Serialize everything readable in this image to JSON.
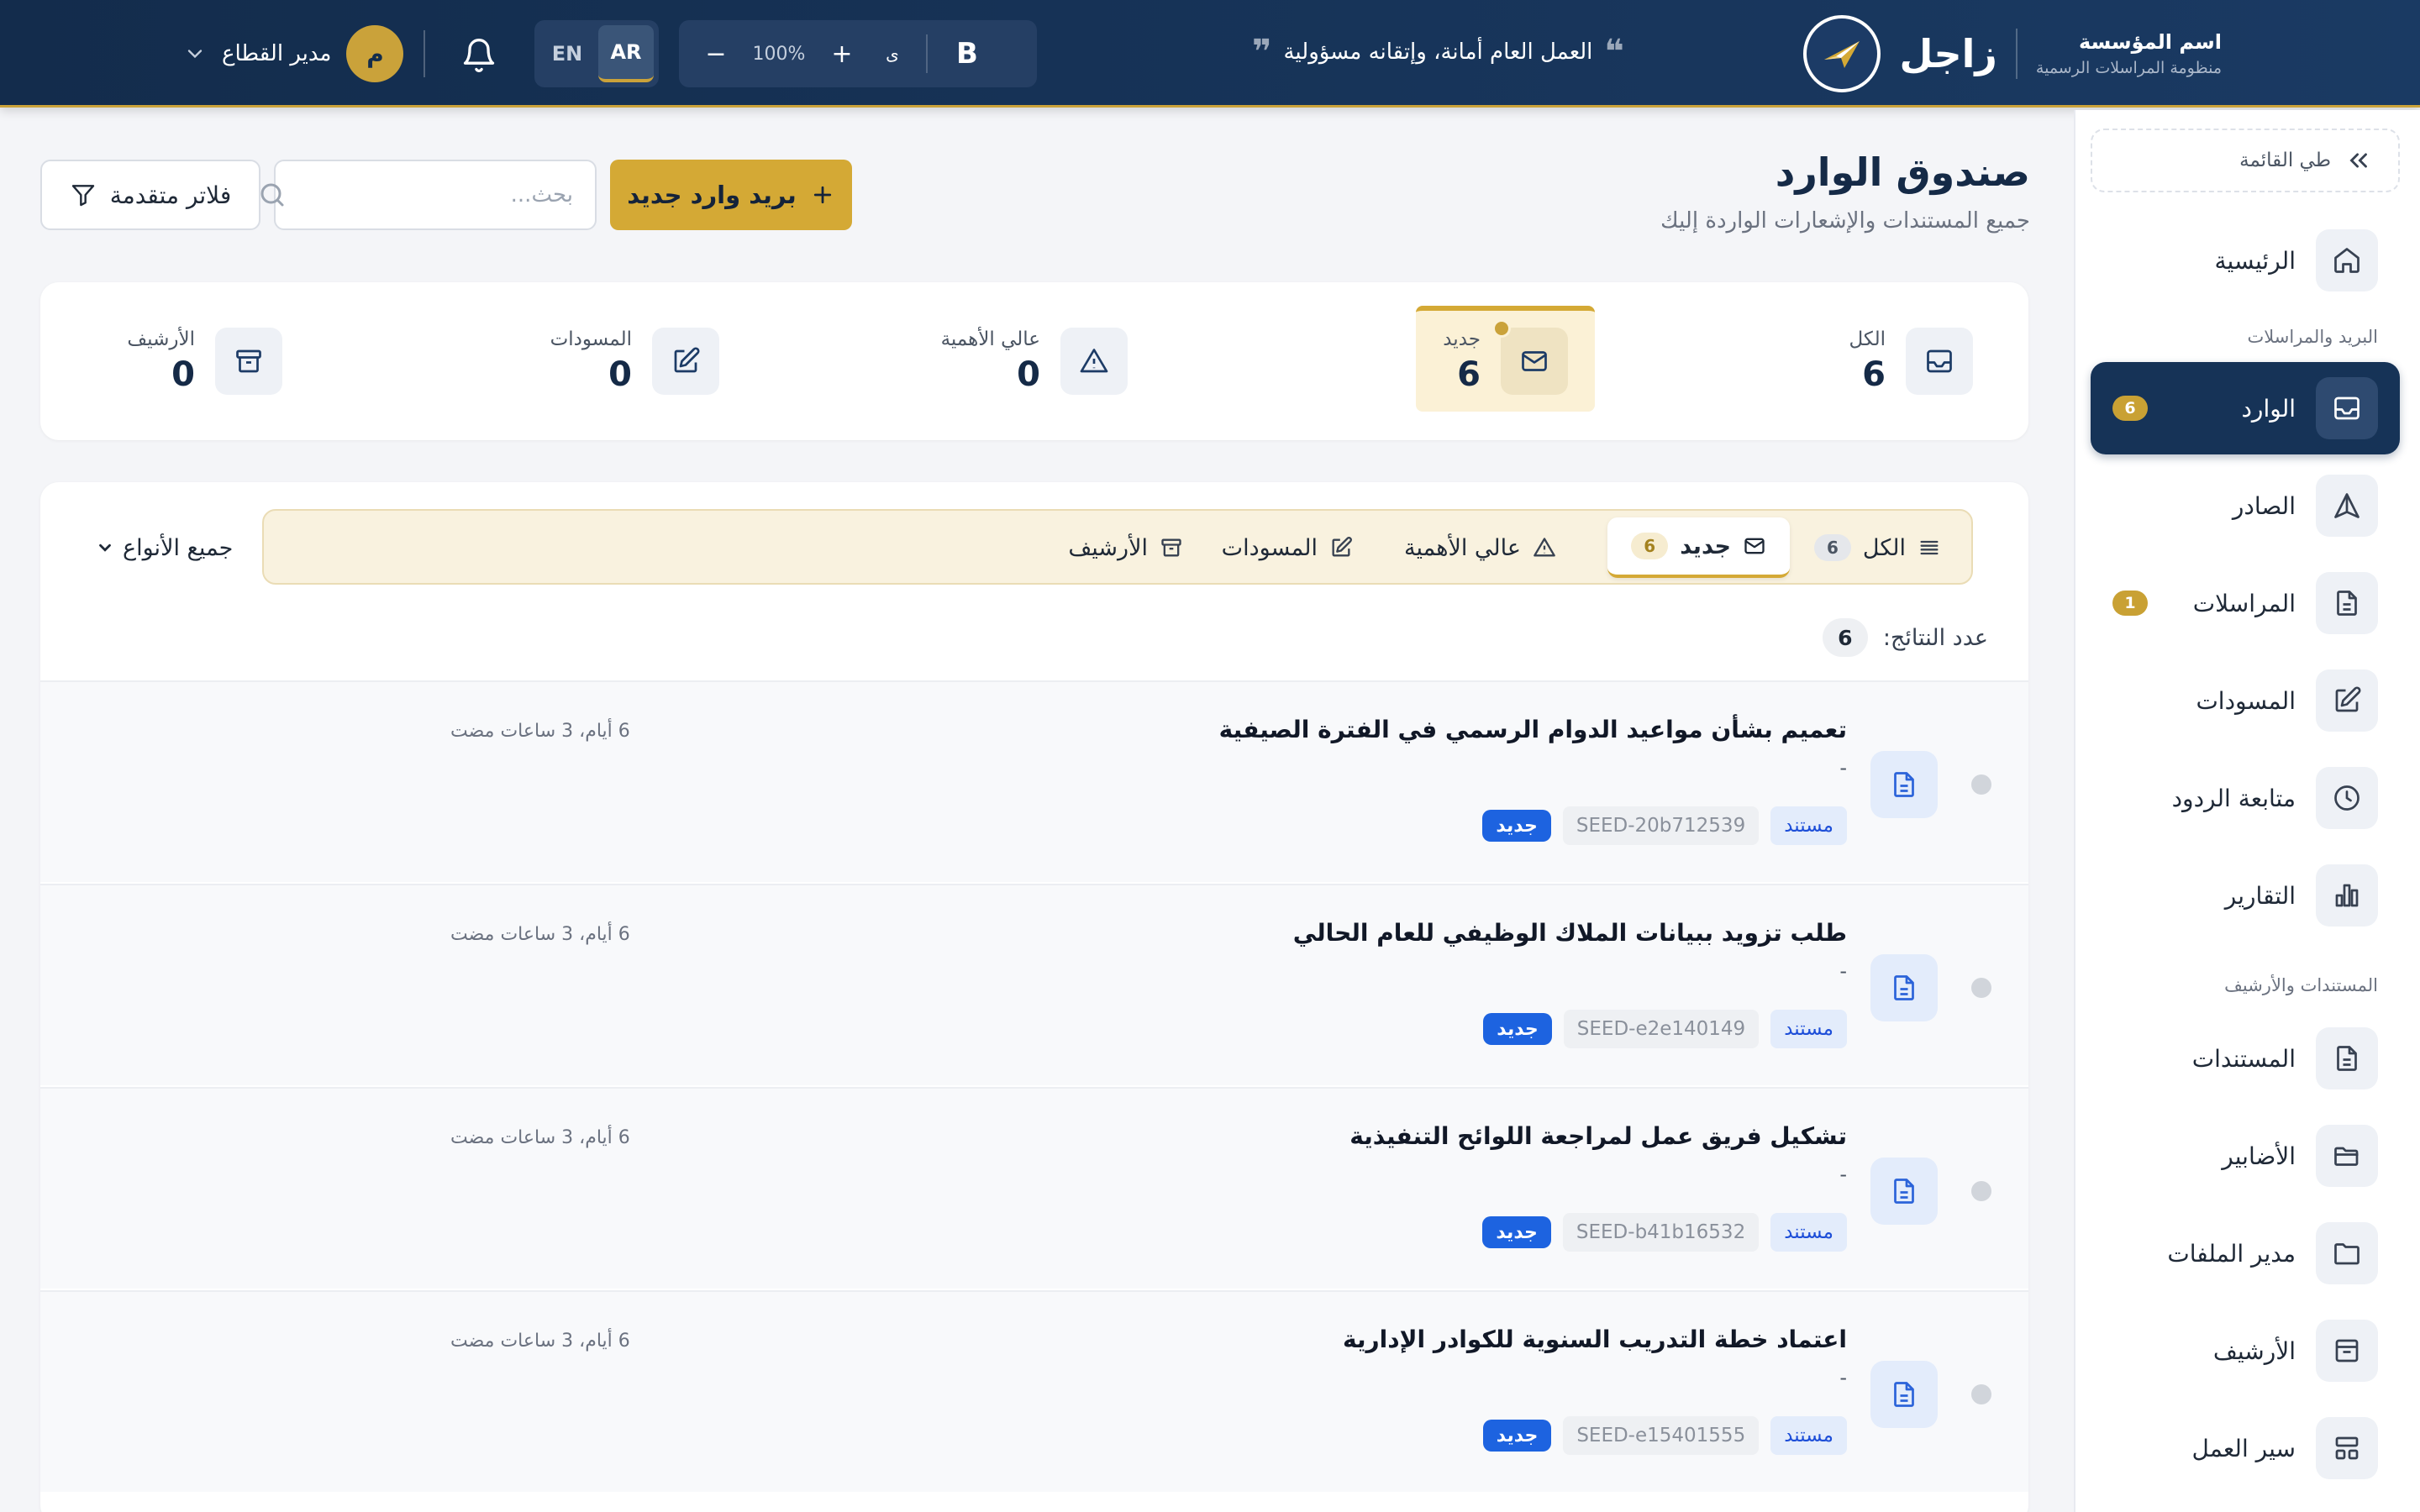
{
  "brand": {
    "name": "زاجل",
    "org_name": "اسم المؤسسة",
    "org_sub": "منظومة المراسلات الرسمية",
    "logo_icon": "paper-plane-icon"
  },
  "header": {
    "motto": "العمل العام أمانة، وإتقانه مسؤولية",
    "zoom": {
      "bold_label": "B",
      "font_label": "ى",
      "plus": "+",
      "value": "100%",
      "minus": "−"
    },
    "lang": {
      "en": "EN",
      "ar": "AR",
      "active": "AR"
    },
    "user": {
      "initial": "م",
      "name": "مدير القطاع"
    },
    "colors": {
      "bg": "#132c4c",
      "accent": "#caa23a"
    }
  },
  "sidebar": {
    "collapse_label": "طي القائمة",
    "home": {
      "label": "الرئيسية",
      "icon": "home-icon"
    },
    "section_mail": "البريد والمراسلات",
    "mail_items": [
      {
        "label": "الوارد",
        "icon": "inbox-icon",
        "badge": "6",
        "active": true
      },
      {
        "label": "الصادر",
        "icon": "send-icon",
        "badge": "",
        "active": false
      },
      {
        "label": "المراسلات",
        "icon": "document-icon",
        "badge": "1",
        "active": false
      },
      {
        "label": "المسودات",
        "icon": "edit-icon",
        "badge": "",
        "active": false
      },
      {
        "label": "متابعة الردود",
        "icon": "clock-icon",
        "badge": "",
        "active": false
      },
      {
        "label": "التقارير",
        "icon": "bar-chart-icon",
        "badge": "",
        "active": false
      }
    ],
    "section_docs": "المستندات والأرشيف",
    "doc_items": [
      {
        "label": "المستندات",
        "icon": "document-icon"
      },
      {
        "label": "الأضابير",
        "icon": "folder-open-icon"
      },
      {
        "label": "مدير الملفات",
        "icon": "folder-icon"
      },
      {
        "label": "الأرشيف",
        "icon": "archive-icon"
      },
      {
        "label": "سير العمل",
        "icon": "workflow-icon"
      }
    ]
  },
  "main": {
    "title": "صندوق الوارد",
    "subtitle": "جميع المستندات والإشعارات الواردة إليك",
    "new_button": "بريد وارد جديد",
    "search_placeholder": "بحث...",
    "filter_button": "فلاتر متقدمة"
  },
  "stats": [
    {
      "label": "الكل",
      "value": "6",
      "icon": "inbox-icon",
      "active": false
    },
    {
      "label": "جديد",
      "value": "6",
      "icon": "envelope-icon",
      "active": true
    },
    {
      "label": "عالي الأهمية",
      "value": "0",
      "icon": "warning-icon",
      "active": false
    },
    {
      "label": "المسودات",
      "value": "0",
      "icon": "edit-icon",
      "active": false
    },
    {
      "label": "الأرشيف",
      "value": "0",
      "icon": "archive-icon",
      "active": false
    }
  ],
  "tabs": [
    {
      "label": "الكل",
      "count": "6",
      "icon": "list-icon",
      "active": false
    },
    {
      "label": "جديد",
      "count": "6",
      "icon": "envelope-icon",
      "active": true
    },
    {
      "label": "عالي الأهمية",
      "count": "",
      "icon": "warning-icon",
      "active": false
    },
    {
      "label": "المسودات",
      "count": "",
      "icon": "edit-icon",
      "active": false
    },
    {
      "label": "الأرشيف",
      "count": "",
      "icon": "archive-icon",
      "active": false
    }
  ],
  "type_filter": "جميع الأنواع",
  "results": {
    "label": "عدد النتائج:",
    "count": "6"
  },
  "items": [
    {
      "title": "تعميم بشأن مواعيد الدوام الرسمي في الفترة الصيفية",
      "subtitle": "-",
      "type": "مستند",
      "code": "SEED-20b712539",
      "status": "جديد",
      "time": "6 أيام، 3 ساعات مضت"
    },
    {
      "title": "طلب تزويد ببيانات الملاك الوظيفي للعام الحالي",
      "subtitle": "-",
      "type": "مستند",
      "code": "SEED-e2e140149",
      "status": "جديد",
      "time": "6 أيام، 3 ساعات مضت"
    },
    {
      "title": "تشكيل فريق عمل لمراجعة اللوائح التنفيذية",
      "subtitle": "-",
      "type": "مستند",
      "code": "SEED-b41b16532",
      "status": "جديد",
      "time": "6 أيام، 3 ساعات مضت"
    },
    {
      "title": "اعتماد خطة التدريب السنوية للكوادر الإدارية",
      "subtitle": "-",
      "type": "مستند",
      "code": "SEED-e15401555",
      "status": "جديد",
      "time": "6 أيام، 3 ساعات مضت"
    }
  ]
}
